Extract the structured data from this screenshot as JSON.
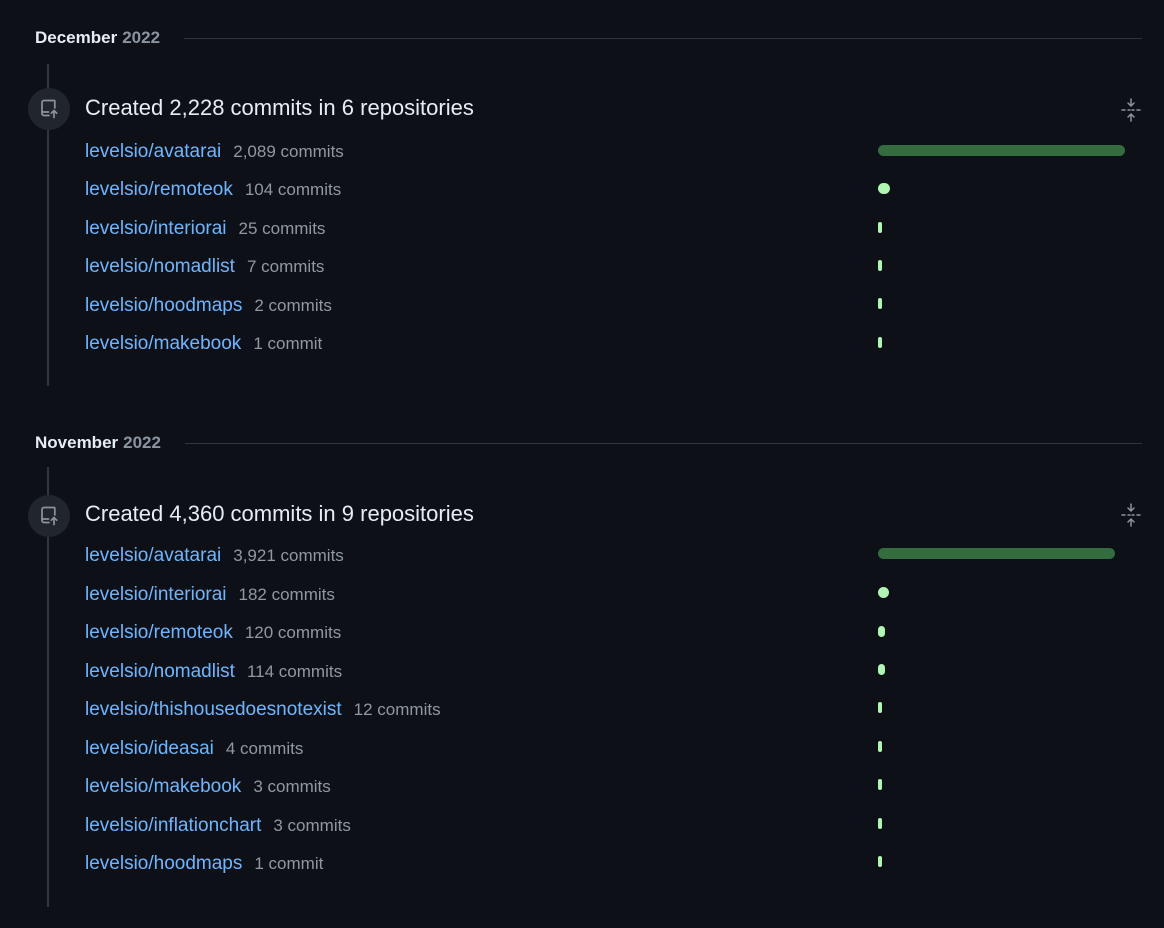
{
  "months": [
    {
      "month": "December",
      "year": "2022",
      "summary": "Created 2,228 commits in 6 repositories",
      "repos": [
        {
          "name": "levelsio/avatarai",
          "count": "2,089 commits",
          "commits": 2089
        },
        {
          "name": "levelsio/remoteok",
          "count": "104 commits",
          "commits": 104
        },
        {
          "name": "levelsio/interiorai",
          "count": "25 commits",
          "commits": 25
        },
        {
          "name": "levelsio/nomadlist",
          "count": "7 commits",
          "commits": 7
        },
        {
          "name": "levelsio/hoodmaps",
          "count": "2 commits",
          "commits": 2
        },
        {
          "name": "levelsio/makebook",
          "count": "1 commit",
          "commits": 1
        }
      ]
    },
    {
      "month": "November",
      "year": "2022",
      "summary": "Created 4,360 commits in 9 repositories",
      "repos": [
        {
          "name": "levelsio/avatarai",
          "count": "3,921 commits",
          "commits": 3921
        },
        {
          "name": "levelsio/interiorai",
          "count": "182 commits",
          "commits": 182
        },
        {
          "name": "levelsio/remoteok",
          "count": "120 commits",
          "commits": 120
        },
        {
          "name": "levelsio/nomadlist",
          "count": "114 commits",
          "commits": 114
        },
        {
          "name": "levelsio/thishousedoesnotexist",
          "count": "12 commits",
          "commits": 12
        },
        {
          "name": "levelsio/ideasai",
          "count": "4 commits",
          "commits": 4
        },
        {
          "name": "levelsio/makebook",
          "count": "3 commits",
          "commits": 3
        },
        {
          "name": "levelsio/inflationchart",
          "count": "3 commits",
          "commits": 3
        },
        {
          "name": "levelsio/hoodmaps",
          "count": "1 commit",
          "commits": 1
        }
      ]
    }
  ],
  "colors": {
    "background": "#0d1117",
    "link": "#6cb6ff",
    "bar_dominant": "#346c3f",
    "bar_light": "#aff5b4",
    "muted": "#9198a1"
  },
  "icons": {
    "badge": "repo-push-icon",
    "collapse": "fold-icon"
  }
}
